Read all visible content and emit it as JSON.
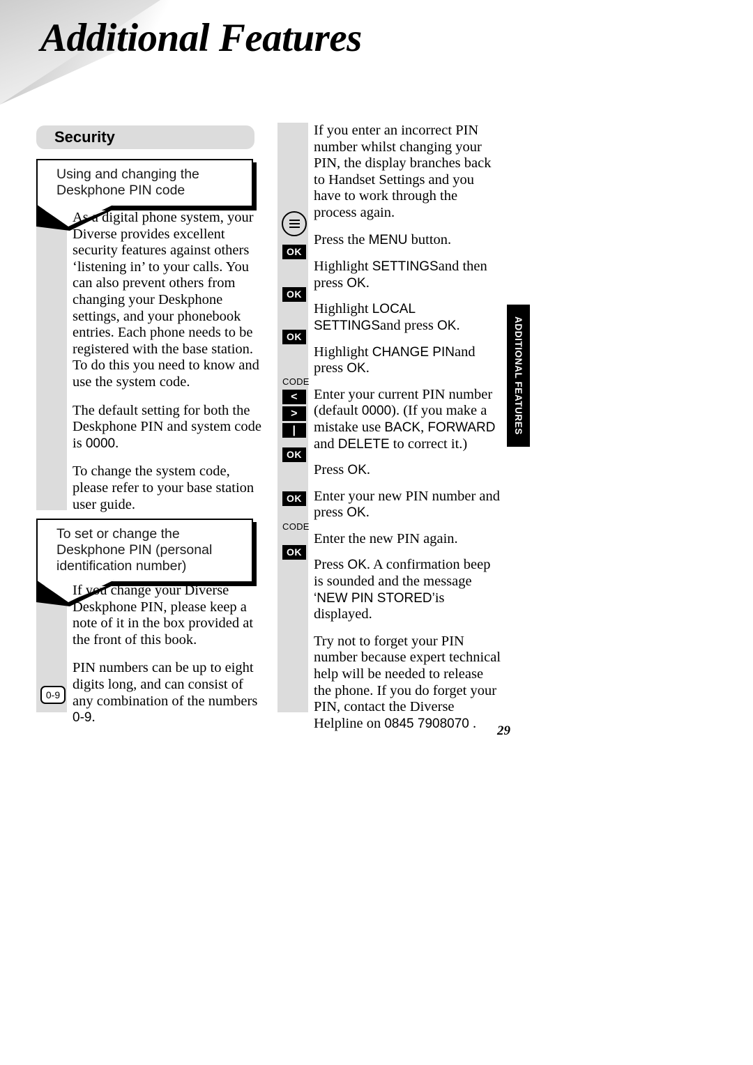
{
  "page": {
    "title": "Additional Features",
    "page_number": "29",
    "side_tab_label": "ADDITIONAL FEATURES"
  },
  "section": {
    "heading": "Security"
  },
  "left_column": {
    "subsection_1": {
      "heading_line_1": "Using and changing the",
      "heading_line_2": "Deskphone PIN code",
      "paragraphs": [
        "As a digital phone system, your Diverse provides excellent security features against others ‘listening in’ to your calls. You can also prevent others from changing your Deskphone settings, and your phonebook entries. Each phone needs to be registered with the base station. To do this you need to know and use the system code.",
        "The default setting for both the Deskphone PIN and system code is 0000.",
        "To change the system code, please refer to your base station user guide."
      ],
      "default_code": "0000"
    },
    "subsection_2": {
      "heading_line_1": "To set or change the",
      "heading_line_2": "Deskphone PIN (personal",
      "heading_line_3": "identification number)",
      "paragraphs": [
        "If you change your Diverse Deskphone PIN, please keep a note of it in the box provided at the front of this book.",
        "PIN numbers can be up to eight digits long, and can consist of any combination of the numbers 0-9."
      ],
      "digit_range": "0-9",
      "key_icon_label": "0-9"
    }
  },
  "right_column": {
    "intro_paragraph": "If you enter an incorrect PIN number whilst changing your PIN, the display branches back to Handset Settings and you have to work through the process again.",
    "steps": [
      {
        "icon": "menu-circle-icon",
        "icon_label": "MENU",
        "text_before": "Press the ",
        "ui_label": "MENU",
        "text_after": " button."
      },
      {
        "icon": "ok-key-icon",
        "icon_label": "OK",
        "text_before": "Highlight ",
        "ui_label": "SETTINGS",
        "text_after": " and then press ",
        "ui_label_2": "OK",
        "text_end": "."
      },
      {
        "icon": "ok-key-icon",
        "icon_label": "OK",
        "text_before": "Highlight ",
        "ui_label": "LOCAL SETTINGS",
        "text_after": " and press ",
        "ui_label_2": "OK",
        "text_end": "."
      },
      {
        "icon": "ok-key-icon",
        "icon_label": "OK",
        "text_before": "Highlight ",
        "ui_label": "CHANGE PIN",
        "text_after": " and press ",
        "ui_label_2": "OK",
        "text_end": "."
      },
      {
        "icon": "code-key-icon",
        "icon_label": "CODE",
        "extra_icons": [
          "back-arrow-key-icon",
          "forward-arrow-key-icon",
          "delete-key-icon"
        ],
        "extra_icon_labels": [
          "<",
          ">",
          "|"
        ],
        "text_before": "Enter your current PIN number (default ",
        "ui_label": "0000",
        "text_after": "). (If you make a mistake use ",
        "ui_label_2": "BACK",
        "text_mid": ", ",
        "ui_label_3": "FORWARD",
        "text_mid_2": " and ",
        "ui_label_4": "DELETE",
        "text_end": " to correct it.)"
      },
      {
        "icon": "ok-key-icon",
        "icon_label": "OK",
        "text_before": "Press ",
        "ui_label": "OK",
        "text_end": "."
      },
      {
        "icon": "ok-key-icon",
        "icon_label": "OK",
        "text_before": "Enter your new PIN number and press ",
        "ui_label": "OK",
        "text_end": "."
      },
      {
        "icon": "code-key-icon",
        "icon_label": "CODE",
        "text_before": "Enter the new PIN again.",
        "ui_label": "",
        "text_end": ""
      },
      {
        "icon": "ok-key-icon",
        "icon_label": "OK",
        "text_before": "Press ",
        "ui_label": "OK",
        "text_after": ". A confirmation beep is sounded and the message ",
        "ui_label_2": "‘NEW PIN STORED’",
        "text_end": " is displayed."
      }
    ],
    "closing_paragraph_before": "Try not to forget your PIN number because expert technical help will be needed to release the phone. If you do forget your PIN, contact the Diverse Helpline on ",
    "helpline_number": "0845 7908070",
    "closing_paragraph_after": "."
  },
  "colors": {
    "gutter_gray": "#dcdcdc",
    "key_black": "#000000",
    "key_text": "#ffffff",
    "page_background": "#ffffff"
  }
}
